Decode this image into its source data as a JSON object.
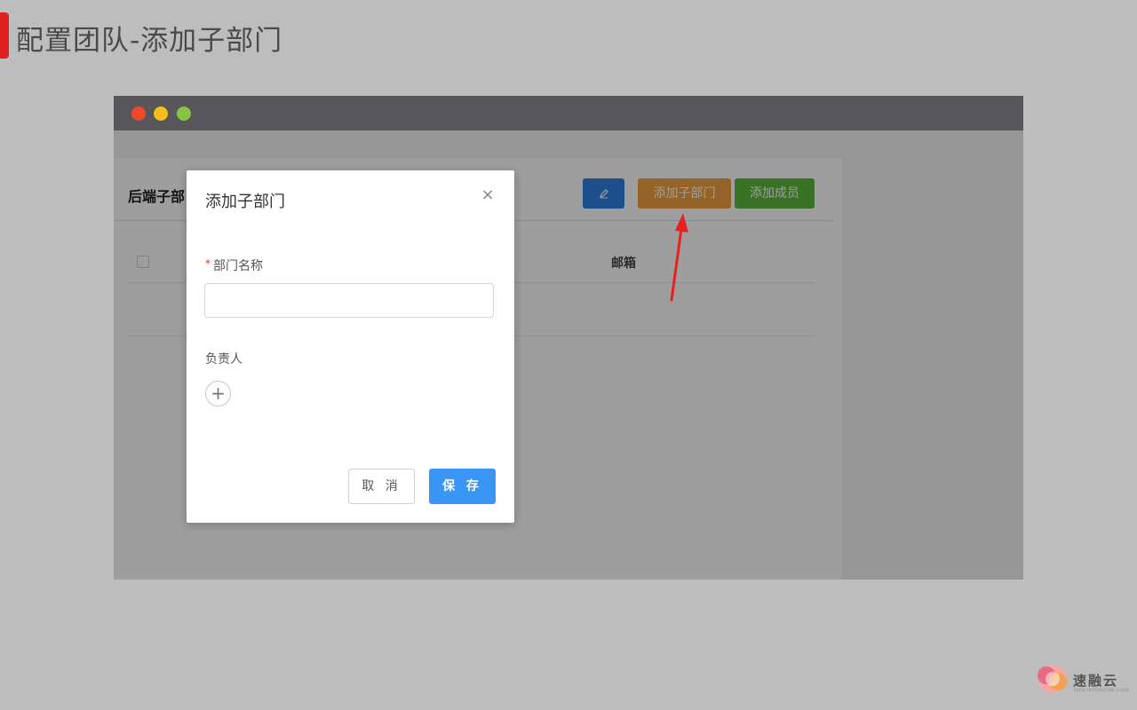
{
  "slide": {
    "title": "配置团队-添加子部门"
  },
  "window": {
    "traffic_lights": [
      "red",
      "yellow",
      "green"
    ]
  },
  "app": {
    "panel_title": "后端子部",
    "buttons": {
      "edit_icon": "pencil-icon",
      "add_sub_department": "添加子部门",
      "add_member": "添加成员"
    },
    "table": {
      "columns": [
        "邮箱"
      ]
    }
  },
  "modal": {
    "title": "添加子部门",
    "close_glyph": "×",
    "department_name_label": "部门名称",
    "required_mark": "*",
    "department_name_value": "",
    "owner_label": "负责人",
    "add_owner_glyph": "+",
    "cancel_label": "取 消",
    "save_label": "保 存"
  },
  "brand": {
    "name": "速融云",
    "tagline": "RAPID INTEGRATION CLOUD"
  },
  "colors": {
    "accent_red": "#e02020",
    "primary_blue": "#3a95f5",
    "orange": "#f0a040",
    "green": "#5cb83a",
    "arrow": "#e82020"
  }
}
